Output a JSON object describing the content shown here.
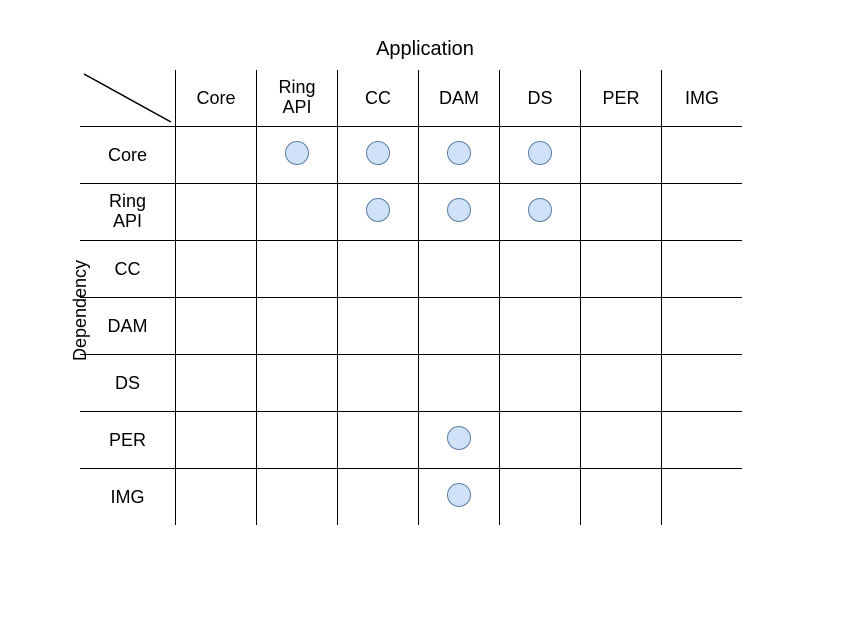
{
  "titleTop": "Application",
  "titleSide": "Dependency",
  "columns": [
    "Core",
    "Ring\nAPI",
    "CC",
    "DAM",
    "DS",
    "PER",
    "IMG"
  ],
  "rows": [
    "Core",
    "Ring\nAPI",
    "CC",
    "DAM",
    "DS",
    "PER",
    "IMG"
  ],
  "chart_data": {
    "type": "table",
    "title": "Application vs Dependency matrix",
    "xlabel": "Application",
    "ylabel": "Dependency",
    "columns": [
      "Core",
      "Ring API",
      "CC",
      "DAM",
      "DS",
      "PER",
      "IMG"
    ],
    "rows": [
      "Core",
      "Ring API",
      "CC",
      "DAM",
      "DS",
      "PER",
      "IMG"
    ],
    "marks": [
      {
        "row": "Core",
        "col": "Ring API"
      },
      {
        "row": "Core",
        "col": "CC"
      },
      {
        "row": "Core",
        "col": "DAM"
      },
      {
        "row": "Core",
        "col": "DS"
      },
      {
        "row": "Ring API",
        "col": "CC"
      },
      {
        "row": "Ring API",
        "col": "DAM"
      },
      {
        "row": "Ring API",
        "col": "DS"
      },
      {
        "row": "PER",
        "col": "DAM"
      },
      {
        "row": "IMG",
        "col": "DAM"
      }
    ]
  }
}
